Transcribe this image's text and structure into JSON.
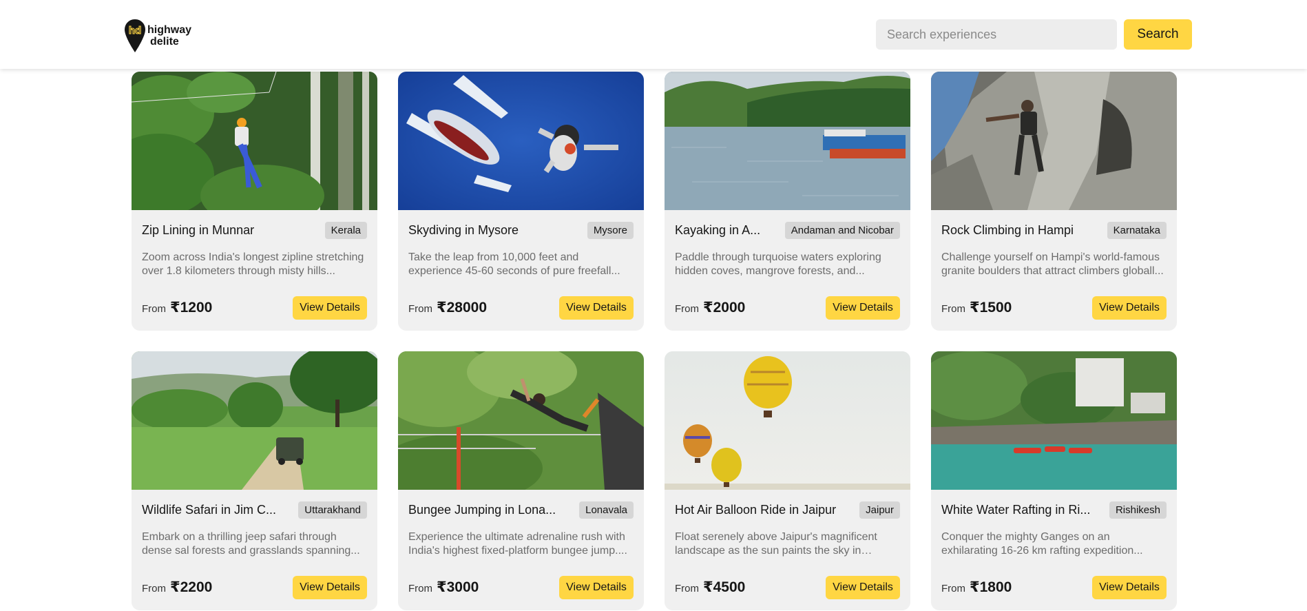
{
  "brand": {
    "line1": "highway",
    "line2": "delite",
    "monogram": "hd",
    "accent": "#ffd643"
  },
  "search": {
    "placeholder": "Search experiences",
    "button_label": "Search"
  },
  "cards": [
    {
      "title": "Zip Lining in Munnar",
      "location": "Kerala",
      "description": "Zoom across India's longest zipline stretching over 1.8 kilometers through misty hills...",
      "price_prefix": "From",
      "price": "₹1200",
      "button_label": "View Details"
    },
    {
      "title": "Skydiving in Mysore",
      "location": "Mysore",
      "description": "Take the leap from 10,000 feet and experience 45-60 seconds of pure freefall...",
      "price_prefix": "From",
      "price": "₹28000",
      "button_label": "View Details"
    },
    {
      "title": "Kayaking in A...",
      "location": "Andaman and Nicobar",
      "description": "Paddle through turquoise waters exploring hidden coves, mangrove forests, and...",
      "price_prefix": "From",
      "price": "₹2000",
      "button_label": "View Details"
    },
    {
      "title": "Rock Climbing in Hampi",
      "location": "Karnataka",
      "description": "Challenge yourself on Hampi's world-famous granite boulders that attract climbers globall...",
      "price_prefix": "From",
      "price": "₹1500",
      "button_label": "View Details"
    },
    {
      "title": "Wildlife Safari in Jim C...",
      "location": "Uttarakhand",
      "description": "Embark on a thrilling jeep safari through dense sal forests and grasslands spanning...",
      "price_prefix": "From",
      "price": "₹2200",
      "button_label": "View Details"
    },
    {
      "title": "Bungee Jumping in Lona...",
      "location": "Lonavala",
      "description": "Experience the ultimate adrenaline rush with India's highest fixed-platform bungee jump....",
      "price_prefix": "From",
      "price": "₹3000",
      "button_label": "View Details"
    },
    {
      "title": "Hot Air Balloon Ride in Jaipur",
      "location": "Jaipur",
      "description": "Float serenely above Jaipur's magnificent landscape as the sun paints the sky in golde...",
      "price_prefix": "From",
      "price": "₹4500",
      "button_label": "View Details"
    },
    {
      "title": "White Water Rafting in Ri...",
      "location": "Rishikesh",
      "description": "Conquer the mighty Ganges on an exhilarating 16-26 km rafting expedition...",
      "price_prefix": "From",
      "price": "₹1800",
      "button_label": "View Details"
    }
  ]
}
